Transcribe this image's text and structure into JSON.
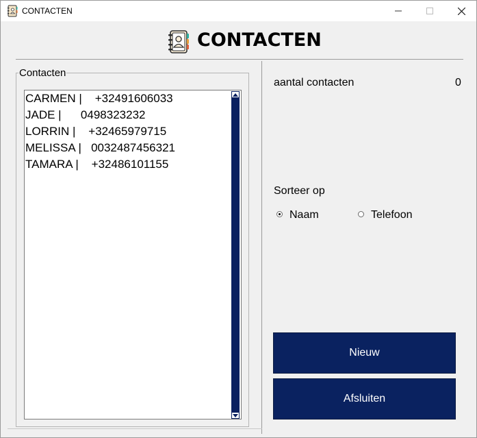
{
  "window": {
    "title": "CONTACTEN",
    "icons": {
      "app": "address-book-icon",
      "minimize": "minimize-icon",
      "maximize": "maximize-icon",
      "close": "close-icon"
    }
  },
  "header": {
    "title": "CONTACTEN",
    "icon": "address-book-icon"
  },
  "contacts_group": {
    "legend": "Contacten",
    "items": [
      "CARMEN |    +32491606033",
      "JADE |      0498323232",
      "LORRIN |    +32465979715",
      "MELISSA |   0032487456321",
      "TAMARA |    +32486101155"
    ]
  },
  "stats": {
    "count_label": "aantal contacten",
    "count_value": "0"
  },
  "sort": {
    "label": "Sorteer op",
    "options": [
      {
        "label": "Naam",
        "selected": true
      },
      {
        "label": "Telefoon",
        "selected": false
      }
    ]
  },
  "buttons": {
    "new": "Nieuw",
    "close": "Afsluiten"
  },
  "colors": {
    "button_bg": "#0a2260",
    "scrollbar": "#0a2060"
  }
}
